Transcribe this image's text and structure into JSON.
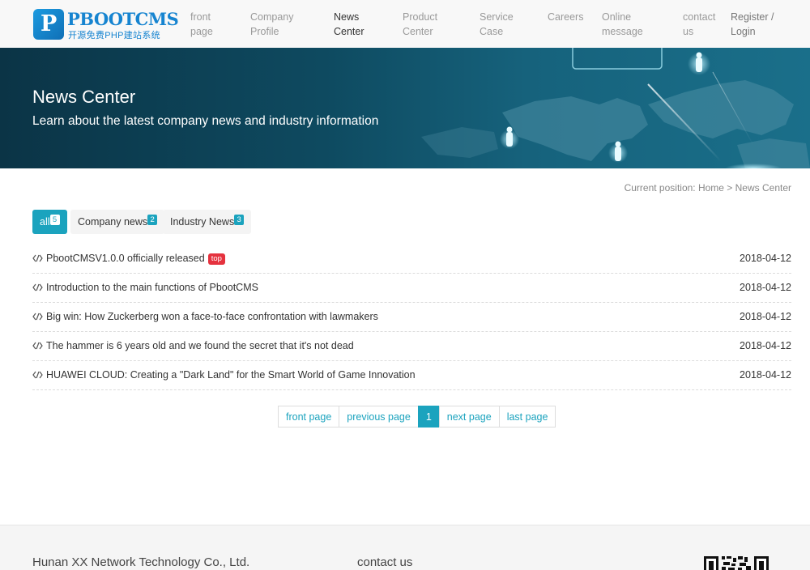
{
  "header": {
    "logo": {
      "name": "PBOOTCMS",
      "mark": "P",
      "tagline": "开源免费PHP建站系统"
    },
    "nav": [
      {
        "line1": "front",
        "line2": "page"
      },
      {
        "line1": "Company",
        "line2": "Profile"
      },
      {
        "line1": "News",
        "line2": "Center"
      },
      {
        "line1": "Product",
        "line2": "Center"
      },
      {
        "line1": "Service",
        "line2": "Case"
      },
      {
        "line1": "Careers",
        "line2": ""
      },
      {
        "line1": "Online",
        "line2": "message"
      },
      {
        "line1": "contact",
        "line2": "us"
      }
    ],
    "active_nav_index": 2,
    "login": {
      "line1": "Register /",
      "line2": "Login"
    }
  },
  "banner": {
    "title": "News Center",
    "subtitle": "Learn about the latest company news and industry information"
  },
  "breadcrumb": "Current position: Home > News Center",
  "tabs": [
    {
      "label": "all",
      "count": "5"
    },
    {
      "label": "Company news",
      "count": "2"
    },
    {
      "label": "Industry News",
      "count": "3"
    }
  ],
  "news": [
    {
      "title": "PbootCMSV1.0.0 officially released",
      "tag": "top",
      "date": "2018-04-12"
    },
    {
      "title": "Introduction to the main functions of PbootCMS",
      "tag": "",
      "date": "2018-04-12"
    },
    {
      "title": "Big win: How Zuckerberg won a face-to-face confrontation with lawmakers",
      "tag": "",
      "date": "2018-04-12"
    },
    {
      "title": "The hammer is 6 years old and we found the secret that it's not dead",
      "tag": "",
      "date": "2018-04-12"
    },
    {
      "title": "HUAWEI CLOUD: Creating a \"Dark Land\" for the Smart World of Game Innovation",
      "tag": "",
      "date": "2018-04-12"
    }
  ],
  "pagination": {
    "first": "front page",
    "prev": "previous page",
    "current": "1",
    "next": "next page",
    "last": "last page"
  },
  "footer": {
    "company": "Hunan XX Network Technology Co., Ltd.",
    "contact": "contact us"
  },
  "colors": {
    "accent": "#1ba3be",
    "tag_red": "#e5323e",
    "logo_blue": "#1684d0"
  }
}
